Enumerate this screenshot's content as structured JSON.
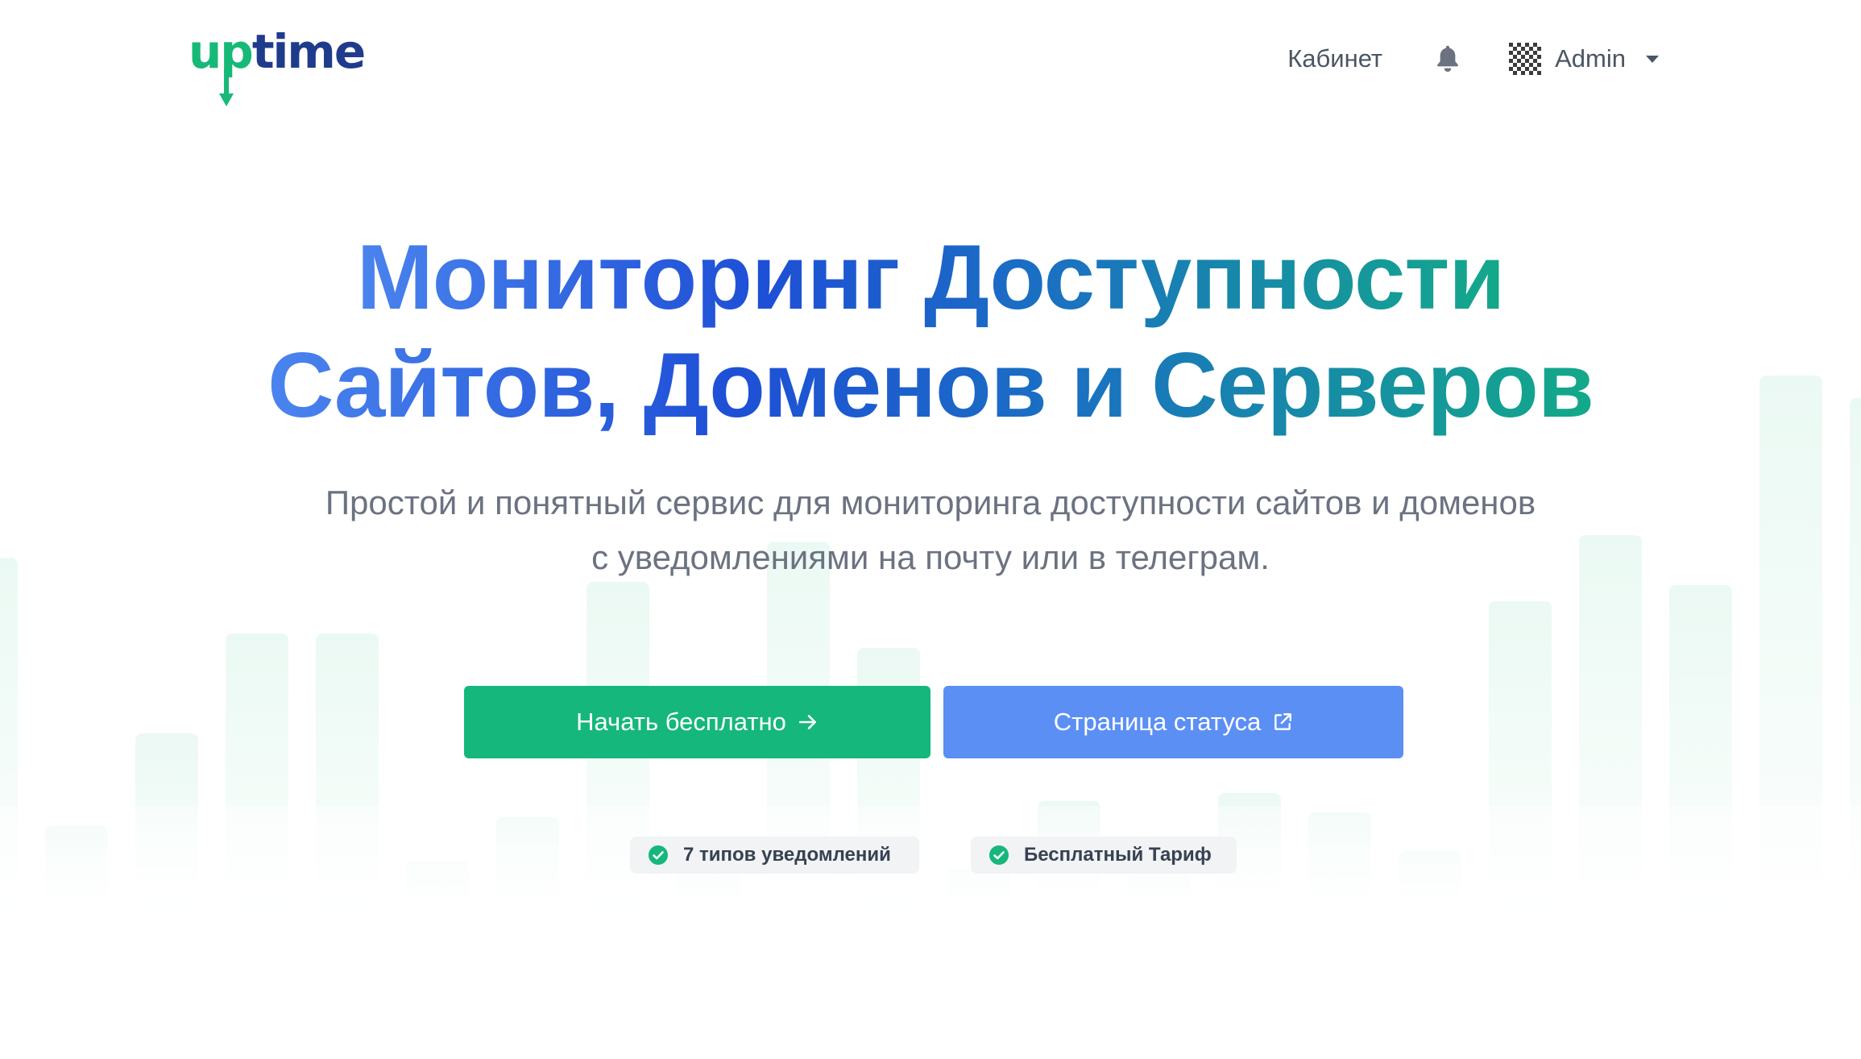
{
  "header": {
    "logo": {
      "part_a": "up",
      "part_b": "time"
    },
    "nav": {
      "cabinet_label": "Кабинет",
      "user_name": "Admin"
    }
  },
  "hero": {
    "title_line_1": "Мониторинг Доступности",
    "title_line_2": "Сайтов, Доменов и Серверов",
    "subtitle": "Простой и понятный сервис для мониторинга доступности сайтов и доменов с уведомлениями на почту или в телеграм."
  },
  "buttons": {
    "start_label": "Начать бесплатно",
    "status_label": "Страница статуса"
  },
  "badges": [
    {
      "label": "7 типов уведомлений"
    },
    {
      "label": "Бесплатный Тариф"
    }
  ],
  "colors": {
    "brand_green": "#15b77c",
    "brand_navy": "#1f3b8c",
    "status_blue": "#5b8ff4",
    "text_gray": "#6b7280"
  },
  "icons": {
    "notifications": "bell-icon",
    "avatar": "pattern-avatar-icon",
    "dropdown": "chevron-down-icon",
    "start_button": "arrow-right-icon",
    "status_button": "external-link-icon",
    "badges": "check-circle-icon"
  }
}
